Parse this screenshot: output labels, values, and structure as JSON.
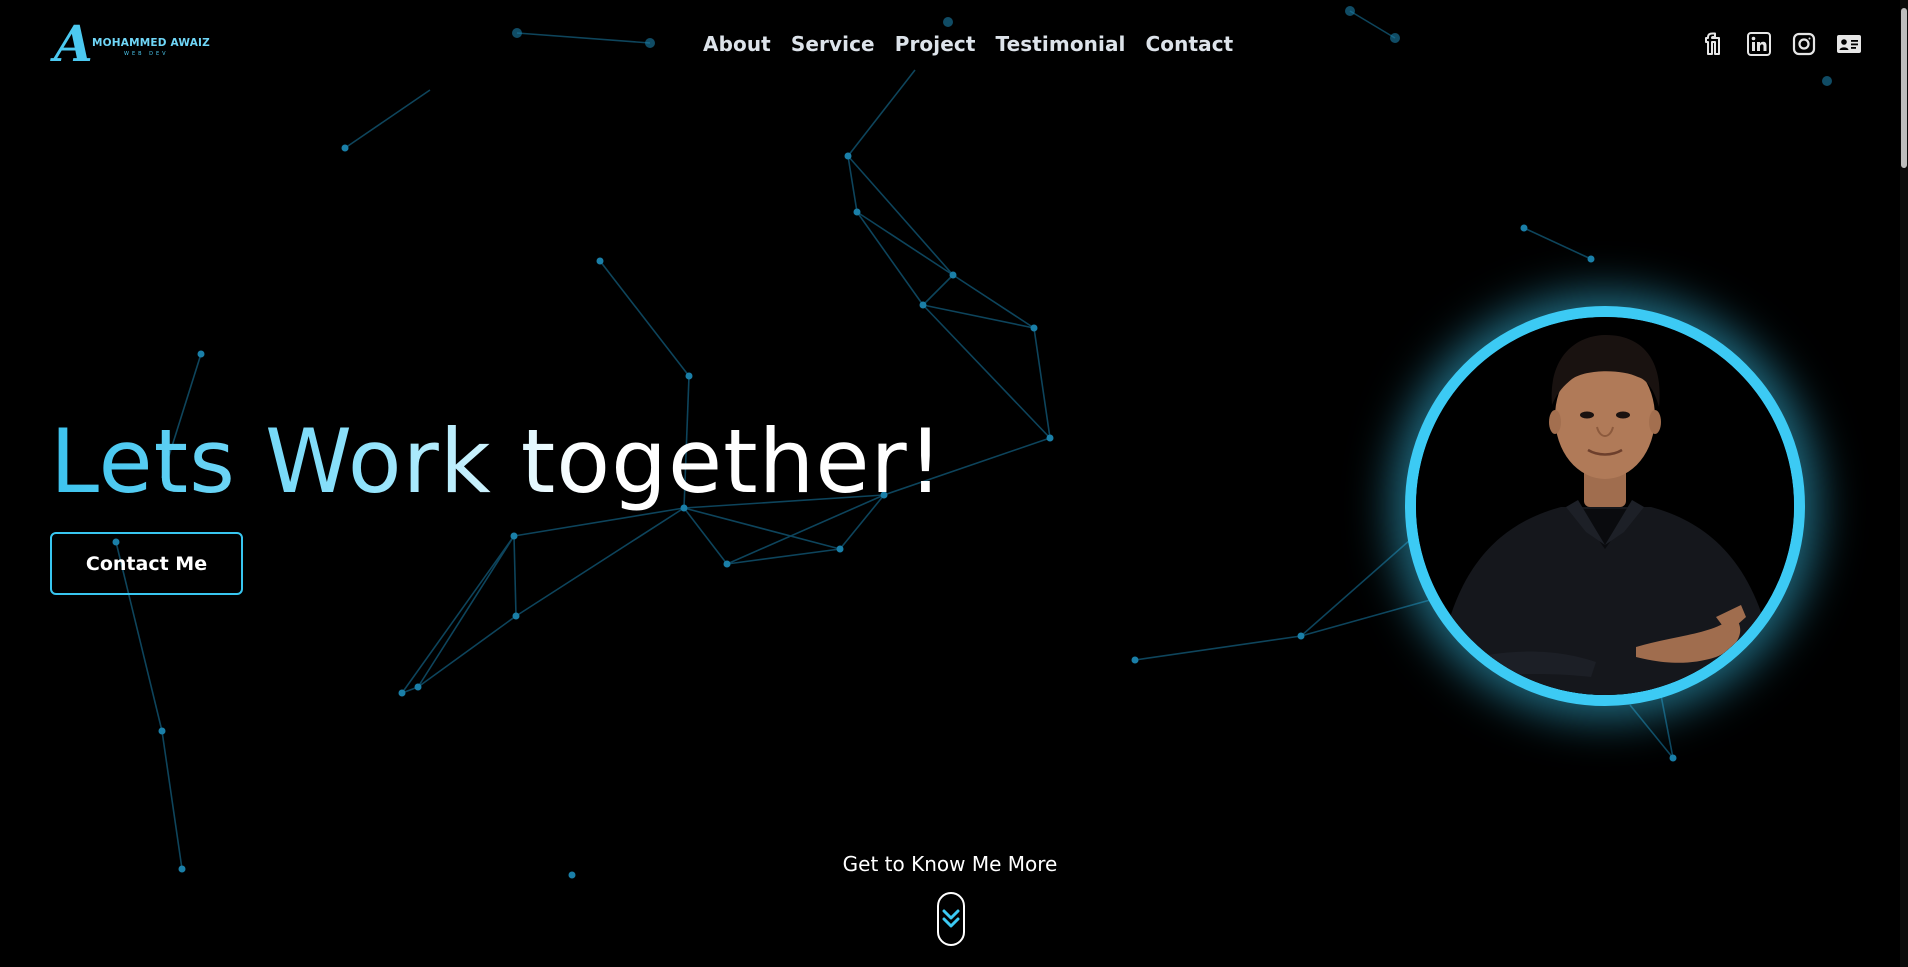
{
  "logo": {
    "mark": "A",
    "name": "MOHAMMED AWAIZ",
    "sub": "WEB DEV"
  },
  "nav": {
    "items": [
      "About",
      "Service",
      "Project",
      "Testimonial",
      "Contact"
    ]
  },
  "social": {
    "icons": [
      "fiverr-icon",
      "linkedin-icon",
      "instagram-icon",
      "contact-card-icon"
    ]
  },
  "hero": {
    "headline": "Lets Work together!",
    "cta_label": "Contact Me"
  },
  "scroll": {
    "label": "Get to Know Me More"
  },
  "colors": {
    "accent": "#3ccaf4",
    "background": "#000000",
    "text": "#ffffff",
    "particles": "#1b7fa8"
  }
}
